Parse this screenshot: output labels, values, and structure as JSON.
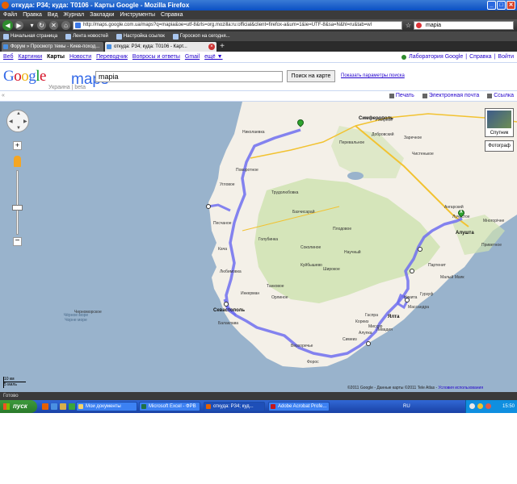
{
  "window": {
    "title": "откуда: Р34; куда: Т0106 - Карты Google - Mozilla Firefox",
    "minimize": "_",
    "maximize": "□",
    "close": "✕"
  },
  "menu": [
    "Файл",
    "Правка",
    "Вид",
    "Журнал",
    "Закладки",
    "Инструменты",
    "Справка"
  ],
  "nav": {
    "url": "http://maps.google.com.ua/maps?q=mapia&oe=utf-8&rls=org.mozilla:ru:official&client=firefox-a&um=1&ie=UTF-8&sa=N&hl=ru&tab=wl",
    "search_value": "mapia"
  },
  "bookmarks": [
    "Начальная страница",
    "Лента новостей",
    "Настройка ссылок",
    "Гороскоп на сегодня..."
  ],
  "tabs": [
    {
      "label": "Форум » Просмотр темы - Киев-поход..."
    },
    {
      "label": "откуда: Р34; куда: Т0106 - Карт..."
    }
  ],
  "gbar": {
    "left": [
      "Веб",
      "Картинки",
      "Карты",
      "Новости",
      "Переводчик",
      "Вопросы и ответы",
      "Gmail",
      "ещё ▼"
    ],
    "current": "Карты",
    "right_lab": "Лаборатория Google",
    "right_sep": "|",
    "right_help": "Справка",
    "right_login": "Войти"
  },
  "header": {
    "logo_google": "Google",
    "logo_maps": "maps",
    "logo_note": "Украина | beta",
    "query": "mapia",
    "search_button": "Поиск на карте",
    "options_link": "Показать параметры поиска"
  },
  "maptools": {
    "print": "Печать",
    "email": "Электронная почта",
    "link": "Ссылка",
    "collapse": "«"
  },
  "map": {
    "satellite": "Спутник",
    "photos": "Фотограф",
    "scale_km": "10 км",
    "scale_mi": "5 миль",
    "credits": "©2011 Google - Данные карты ©2011 Tele Atlas",
    "terms": "Условия использования",
    "marker_start": "",
    "marker_end": "A",
    "places": [
      {
        "name": "Симферополь",
        "kind": "city"
      },
      {
        "name": "Севастополь",
        "kind": "city"
      },
      {
        "name": "Бахчисарай",
        "kind": "town"
      },
      {
        "name": "Ялта",
        "kind": "city"
      },
      {
        "name": "Алушта",
        "kind": "city"
      },
      {
        "name": "Партенит",
        "kind": "town"
      },
      {
        "name": "Гурзуф",
        "kind": "town"
      },
      {
        "name": "Массандра",
        "kind": "town"
      },
      {
        "name": "Форос",
        "kind": "town"
      },
      {
        "name": "Балаклава",
        "kind": "town"
      },
      {
        "name": "Инкерман",
        "kind": "town"
      },
      {
        "name": "Кача",
        "kind": "town"
      },
      {
        "name": "Песчаное",
        "kind": "town"
      },
      {
        "name": "Угловое",
        "kind": "town"
      },
      {
        "name": "Любимовка",
        "kind": "town"
      },
      {
        "name": "Перевальное",
        "kind": "town"
      },
      {
        "name": "Соколиное",
        "kind": "town"
      },
      {
        "name": "Куйбышево",
        "kind": "town"
      },
      {
        "name": "Научный",
        "kind": "town"
      },
      {
        "name": "Трудолюбовка",
        "kind": "town"
      },
      {
        "name": "Добровский",
        "kind": "town"
      },
      {
        "name": "Николаевка",
        "kind": "town"
      },
      {
        "name": "Черноморское",
        "kind": "town"
      },
      {
        "name": "Симеиз",
        "kind": "town"
      },
      {
        "name": "Алупка",
        "kind": "town"
      },
      {
        "name": "Мисхор",
        "kind": "town"
      },
      {
        "name": "Кореиз",
        "kind": "town"
      },
      {
        "name": "Верхоречье",
        "kind": "town"
      },
      {
        "name": "Танковое",
        "kind": "town"
      },
      {
        "name": "Орлиное",
        "kind": "town"
      },
      {
        "name": "Малый Маяк",
        "kind": "town"
      },
      {
        "name": "Лучистое",
        "kind": "town"
      },
      {
        "name": "Многорічне",
        "kind": "town"
      },
      {
        "name": "Приветное",
        "kind": "town"
      },
      {
        "name": "Ангарский",
        "kind": "town"
      },
      {
        "name": "Заречное",
        "kind": "town"
      },
      {
        "name": "Чистенькое",
        "kind": "town"
      },
      {
        "name": "Мирное",
        "kind": "town"
      },
      {
        "name": "Никита",
        "kind": "town"
      },
      {
        "name": "Ливадия",
        "kind": "town"
      },
      {
        "name": "Гаспра",
        "kind": "town"
      },
      {
        "name": "Голубинка",
        "kind": "town"
      },
      {
        "name": "Плодовое",
        "kind": "town"
      },
      {
        "name": "Широкое",
        "kind": "town"
      },
      {
        "name": "Поворотное",
        "kind": "town"
      }
    ],
    "sea_label": "Чёрное море Чорне море"
  },
  "status": "Готово",
  "taskbar": {
    "start": "пуск",
    "tasks": [
      {
        "label": "Мои документы"
      },
      {
        "label": "Microsoft Excel - ФРВ"
      },
      {
        "label": "откуда: Р34; куд..."
      },
      {
        "label": "Adobe Acrobat Profe..."
      }
    ],
    "lang": "RU",
    "clock": "15:50"
  },
  "colors": {
    "route": "#6f6ff0",
    "land": "#f4f0e8",
    "forest": "#cfe3b2",
    "sea": "#99b3cc",
    "titlebar": "#0a4fc4"
  }
}
